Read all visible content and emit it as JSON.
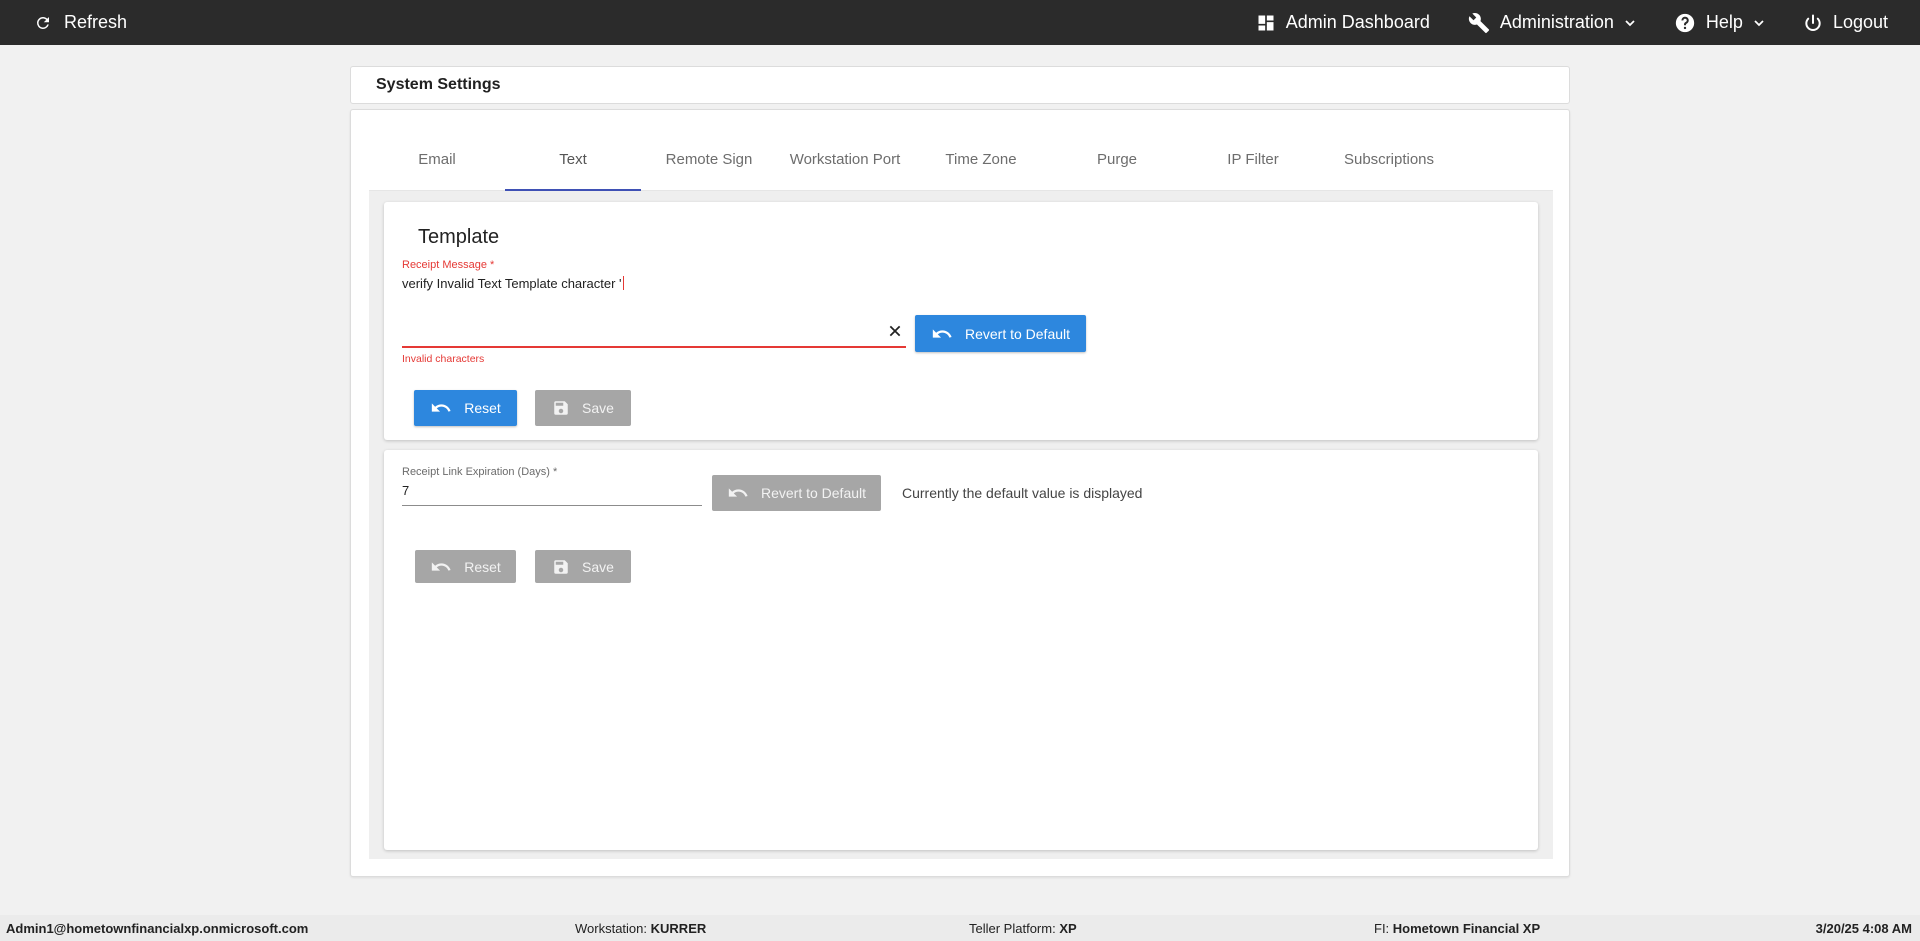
{
  "topbar": {
    "refresh_label": "Refresh",
    "admin_dashboard_label": "Admin Dashboard",
    "administration_label": "Administration",
    "help_label": "Help",
    "logout_label": "Logout",
    "icons": [
      "refresh-icon",
      "dashboard-icon",
      "wrench-icon",
      "chevron-down-icon",
      "help-circle-icon",
      "power-icon"
    ]
  },
  "page_title": "System Settings",
  "tabs": [
    {
      "label": "Email",
      "active": false
    },
    {
      "label": "Text",
      "active": true
    },
    {
      "label": "Remote Sign",
      "active": false
    },
    {
      "label": "Workstation Port",
      "active": false
    },
    {
      "label": "Time Zone",
      "active": false
    },
    {
      "label": "Purge",
      "active": false
    },
    {
      "label": "IP Filter",
      "active": false
    },
    {
      "label": "Subscriptions",
      "active": false
    }
  ],
  "template_card": {
    "title": "Template",
    "receipt_message": {
      "label": "Receipt Message *",
      "value": "verify Invalid Text Template character '",
      "error": "Invalid characters"
    },
    "revert_label": "Revert to Default",
    "reset_label": "Reset",
    "save_label": "Save"
  },
  "expiration_card": {
    "label": "Receipt Link Expiration (Days) *",
    "value": "7",
    "revert_label": "Revert to Default",
    "info": "Currently the default value is displayed",
    "reset_label": "Reset",
    "save_label": "Save"
  },
  "footer": {
    "user": "Admin1@hometownfinancialxp.onmicrosoft.com",
    "workstation_label": "Workstation:",
    "workstation_value": "KURRER",
    "platform_label": "Teller Platform:",
    "platform_value": "XP",
    "fi_label": "FI:",
    "fi_value": "Hometown Financial XP",
    "datetime": "3/20/25 4:08 AM"
  },
  "colors": {
    "topbar": "#2b2b2b",
    "primary_button": "#2d87de",
    "disabled_button": "#a6a6a6",
    "error": "#e53935",
    "tab_indicator": "#3f51b5"
  }
}
